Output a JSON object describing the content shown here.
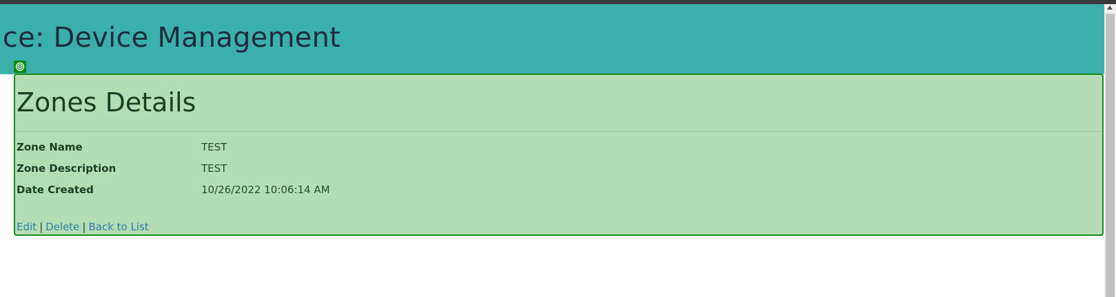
{
  "header": {
    "title": "ffice: Device Management"
  },
  "details": {
    "title": "Zones Details",
    "fields": [
      {
        "label": "Zone Name",
        "value": "TEST"
      },
      {
        "label": "Zone Description",
        "value": "TEST"
      },
      {
        "label": "Date Created",
        "value": "10/26/2022 10:06:14 AM"
      }
    ]
  },
  "actions": {
    "edit": "Edit",
    "delete": "Delete",
    "back": "Back to List",
    "separator": "|"
  },
  "icons": {
    "target": "target-icon"
  },
  "colors": {
    "header_bg": "#3bafaa",
    "highlight_bg": "#b4ddb6",
    "highlight_border": "#1c8a1c",
    "link": "#2a7fa8"
  }
}
